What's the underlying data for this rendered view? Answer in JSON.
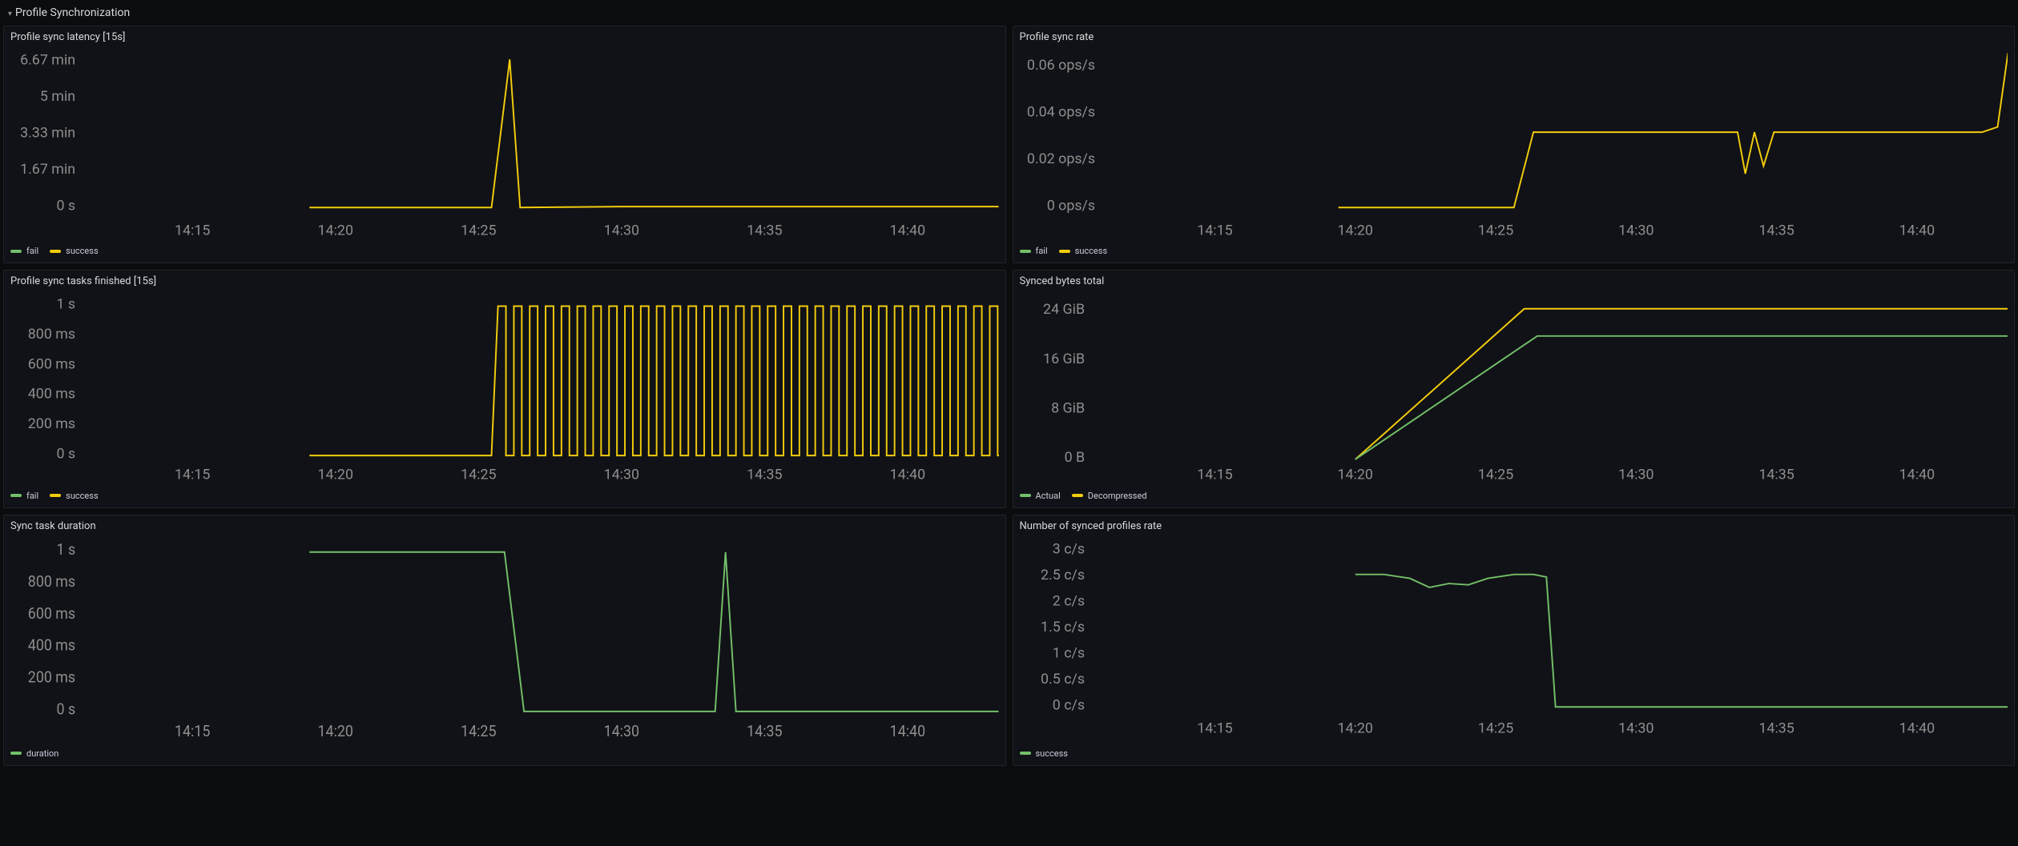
{
  "section": {
    "title": "Profile Synchronization"
  },
  "colors": {
    "green": "#73BF69",
    "yellow": "#F2CC0C"
  },
  "x_common": [
    "14:15",
    "14:20",
    "14:25",
    "14:30",
    "14:35",
    "14:40"
  ],
  "panels": {
    "latency": {
      "title": "Profile sync latency [15s]",
      "yTicks": [
        "6.67 min",
        "5 min",
        "3.33 min",
        "1.67 min",
        "0 s"
      ],
      "legend": [
        {
          "name": "fail",
          "color": "green"
        },
        {
          "name": "success",
          "color": "yellow"
        }
      ]
    },
    "rate": {
      "title": "Profile sync rate",
      "yTicks": [
        "0.06 ops/s",
        "0.04 ops/s",
        "0.02 ops/s",
        "0 ops/s"
      ],
      "legend": [
        {
          "name": "fail",
          "color": "green"
        },
        {
          "name": "success",
          "color": "yellow"
        }
      ]
    },
    "tasks": {
      "title": "Profile sync tasks finished [15s]",
      "yTicks": [
        "1 s",
        "800 ms",
        "600 ms",
        "400 ms",
        "200 ms",
        "0 s"
      ],
      "legend": [
        {
          "name": "fail",
          "color": "green"
        },
        {
          "name": "success",
          "color": "yellow"
        }
      ]
    },
    "bytes": {
      "title": "Synced bytes total",
      "yTicks": [
        "24 GiB",
        "16 GiB",
        "8 GiB",
        "0 B"
      ],
      "legend": [
        {
          "name": "Actual",
          "color": "green"
        },
        {
          "name": "Decompressed",
          "color": "yellow"
        }
      ]
    },
    "duration": {
      "title": "Sync task duration",
      "yTicks": [
        "1 s",
        "800 ms",
        "600 ms",
        "400 ms",
        "200 ms",
        "0 s"
      ],
      "legend": [
        {
          "name": "duration",
          "color": "green"
        }
      ]
    },
    "profilesRate": {
      "title": "Number of synced profiles rate",
      "yTicks": [
        "3 c/s",
        "2.5 c/s",
        "2 c/s",
        "1.5 c/s",
        "1 c/s",
        "0.5 c/s",
        "0 c/s"
      ],
      "legend": [
        {
          "name": "success",
          "color": "green"
        }
      ]
    }
  },
  "chart_data": [
    {
      "id": "latency",
      "type": "line",
      "title": "Profile sync latency [15s]",
      "xlabel": "",
      "ylabel": "",
      "x": [
        "14:15",
        "14:20",
        "14:25",
        "14:26",
        "14:27",
        "14:30",
        "14:35",
        "14:40",
        "14:43"
      ],
      "ylim": [
        0,
        400
      ],
      "y_unit": "seconds",
      "series": [
        {
          "name": "fail",
          "values": [
            null,
            null,
            null,
            null,
            null,
            null,
            null,
            null,
            null
          ]
        },
        {
          "name": "success",
          "values": [
            0,
            0,
            0,
            400,
            0,
            2,
            2,
            2,
            2
          ]
        }
      ]
    },
    {
      "id": "rate",
      "type": "line",
      "title": "Profile sync rate",
      "xlabel": "",
      "ylabel": "ops/s",
      "x": [
        "14:15",
        "14:20",
        "14:25",
        "14:26",
        "14:27",
        "14:30",
        "14:34",
        "14:35",
        "14:36",
        "14:40",
        "14:42",
        "14:43"
      ],
      "ylim": [
        0,
        0.067
      ],
      "series": [
        {
          "name": "fail",
          "values": [
            null,
            null,
            null,
            null,
            null,
            null,
            null,
            null,
            null,
            null,
            null,
            null
          ]
        },
        {
          "name": "success",
          "values": [
            null,
            0,
            0,
            0,
            0.033,
            0.033,
            0.033,
            0.018,
            0.033,
            0.033,
            0.033,
            0.067
          ]
        }
      ]
    },
    {
      "id": "tasks",
      "type": "line",
      "title": "Profile sync tasks finished [15s]",
      "xlabel": "",
      "ylabel": "ms",
      "ylim": [
        0,
        1000
      ],
      "note": "success oscillates 0↔1000 ms every ~15s from ~14:26 onward; fail absent",
      "series": [
        {
          "name": "fail",
          "values": []
        },
        {
          "name": "success",
          "values": []
        }
      ]
    },
    {
      "id": "bytes",
      "type": "line",
      "title": "Synced bytes total",
      "xlabel": "",
      "ylabel": "GiB",
      "x": [
        "14:15",
        "14:20",
        "14:25",
        "14:27",
        "14:30",
        "14:35",
        "14:40",
        "14:43"
      ],
      "ylim": [
        0,
        27
      ],
      "series": [
        {
          "name": "Actual",
          "values": [
            null,
            0,
            16,
            20.5,
            20.5,
            20.5,
            20.5,
            20.5
          ]
        },
        {
          "name": "Decompressed",
          "values": [
            null,
            0,
            19,
            25,
            25,
            25,
            25,
            25
          ]
        }
      ]
    },
    {
      "id": "duration",
      "type": "line",
      "title": "Sync task duration",
      "xlabel": "",
      "ylabel": "ms",
      "x": [
        "14:15",
        "14:20",
        "14:25",
        "14:26",
        "14:27",
        "14:33",
        "14:33.5",
        "14:34",
        "14:35",
        "14:40",
        "14:43"
      ],
      "ylim": [
        0,
        1000
      ],
      "series": [
        {
          "name": "duration",
          "values": [
            null,
            1000,
            1000,
            1000,
            0,
            0,
            1000,
            0,
            0,
            0,
            0
          ]
        }
      ]
    },
    {
      "id": "profilesRate",
      "type": "line",
      "title": "Number of synced profiles rate",
      "xlabel": "",
      "ylabel": "c/s",
      "x": [
        "14:15",
        "14:20",
        "14:21",
        "14:22",
        "14:23",
        "14:24",
        "14:25",
        "14:26",
        "14:27",
        "14:28",
        "14:30",
        "14:35",
        "14:40",
        "14:43"
      ],
      "ylim": [
        0,
        3
      ],
      "series": [
        {
          "name": "success",
          "values": [
            null,
            2.55,
            2.55,
            2.5,
            2.35,
            2.4,
            2.5,
            2.55,
            2.55,
            0,
            0,
            0,
            0,
            0
          ]
        }
      ]
    }
  ]
}
